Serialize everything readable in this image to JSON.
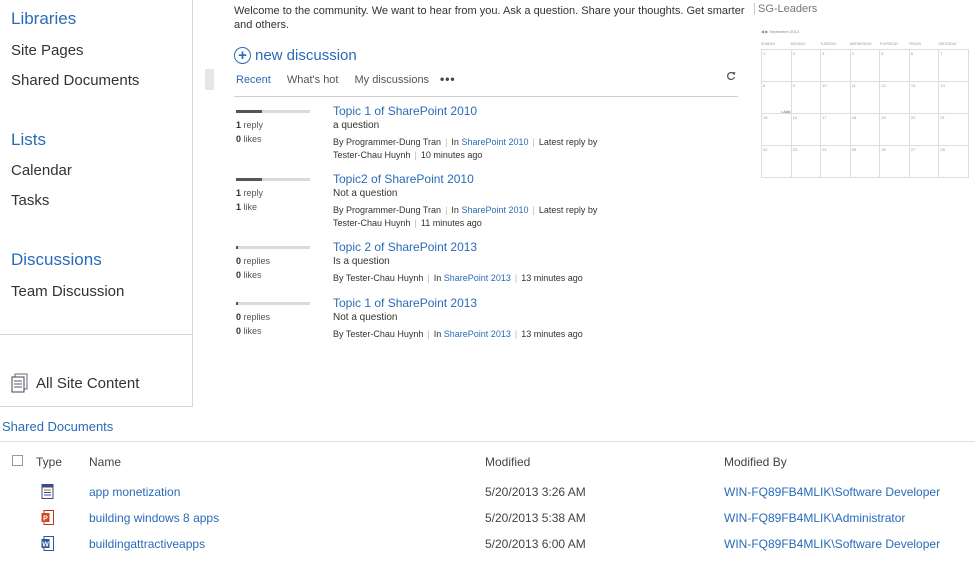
{
  "nav": {
    "libraries_heading": "Libraries",
    "site_pages": "Site Pages",
    "shared_documents": "Shared Documents",
    "lists_heading": "Lists",
    "calendar": "Calendar",
    "tasks": "Tasks",
    "discussions_heading": "Discussions",
    "team_discussion": "Team Discussion",
    "all_site_content": "All Site Content"
  },
  "welcome": {
    "text": "Welcome to the community. We want to hear from you. Ask a question. Share your thoughts. Get smarter and others.",
    "side_label": "SG-Leaders"
  },
  "new_discussion": {
    "label": "new discussion"
  },
  "tabs": [
    {
      "label": "Recent",
      "active": true
    },
    {
      "label": "What's hot",
      "active": false
    },
    {
      "label": "My discussions",
      "active": false
    }
  ],
  "tabs_more": "•••",
  "discussions": [
    {
      "title": "Topic 1 of SharePoint 2010",
      "description": "a question",
      "replies_count": "1",
      "replies_label": "reply",
      "likes_count": "0",
      "likes_label": "likes",
      "activity_level": 0.35,
      "by_prefix": "By",
      "author": "Programmer-Dung Tran",
      "in_prefix": "In",
      "category": "SharePoint 2010",
      "latest_label": "Latest reply by",
      "latest_author": "Tester-Chau Huynh",
      "time": "10 minutes ago"
    },
    {
      "title": "Topic2 of SharePoint 2010",
      "description": "Not a question",
      "replies_count": "1",
      "replies_label": "reply",
      "likes_count": "1",
      "likes_label": "like",
      "activity_level": 0.35,
      "by_prefix": "By",
      "author": "Programmer-Dung Tran",
      "in_prefix": "In",
      "category": "SharePoint 2010",
      "latest_label": "Latest reply by",
      "latest_author": "Tester-Chau Huynh",
      "time": "11 minutes ago"
    },
    {
      "title": "Topic 2 of SharePoint 2013",
      "description": "Is a question",
      "replies_count": "0",
      "replies_label": "replies",
      "likes_count": "0",
      "likes_label": "likes",
      "activity_level": 0.03,
      "by_prefix": "By",
      "author": "Tester-Chau Huynh",
      "in_prefix": "In",
      "category": "SharePoint 2013",
      "time": "13 minutes ago"
    },
    {
      "title": "Topic 1 of SharePoint 2013",
      "description": "Not a question",
      "replies_count": "0",
      "replies_label": "replies",
      "likes_count": "0",
      "likes_label": "likes",
      "activity_level": 0.03,
      "by_prefix": "By",
      "author": "Tester-Chau Huynh",
      "in_prefix": "In",
      "category": "SharePoint 2013",
      "time": "13 minutes ago"
    }
  ],
  "calendar": {
    "month": "September 2013",
    "days": [
      "SUNDAY",
      "MONDAY",
      "TUESDAY",
      "WEDNESDAY",
      "THURSDAY",
      "FRIDAY",
      "SATURDAY"
    ],
    "dates": [
      "1",
      "2",
      "3",
      "4",
      "5",
      "6",
      "7",
      "8",
      "9",
      "10",
      "11",
      "12",
      "13",
      "14",
      "15",
      "16",
      "17",
      "18",
      "19",
      "20",
      "21",
      "22",
      "23",
      "24",
      "25",
      "26",
      "27",
      "28"
    ],
    "event": "• Add"
  },
  "documents": {
    "title": "Shared Documents",
    "columns": {
      "type": "Type",
      "name": "Name",
      "modified": "Modified",
      "modified_by": "Modified By"
    },
    "rows": [
      {
        "icon": "text-document-icon",
        "name": "app monetization",
        "modified": "5/20/2013 3:26 AM",
        "modified_by": "WIN-FQ89FB4MLIK\\Software Developer"
      },
      {
        "icon": "powerpoint-icon",
        "name": "building windows 8 apps",
        "modified": "5/20/2013 5:38 AM",
        "modified_by": "WIN-FQ89FB4MLIK\\Administrator"
      },
      {
        "icon": "word-icon",
        "name": "buildingattractiveapps",
        "modified": "5/20/2013 6:00 AM",
        "modified_by": "WIN-FQ89FB4MLIK\\Software Developer"
      }
    ]
  },
  "colors": {
    "link": "#2a6bb8",
    "text": "#444444",
    "border": "#d8d8d8",
    "powerpoint": "#d24726",
    "word": "#2b579a"
  }
}
